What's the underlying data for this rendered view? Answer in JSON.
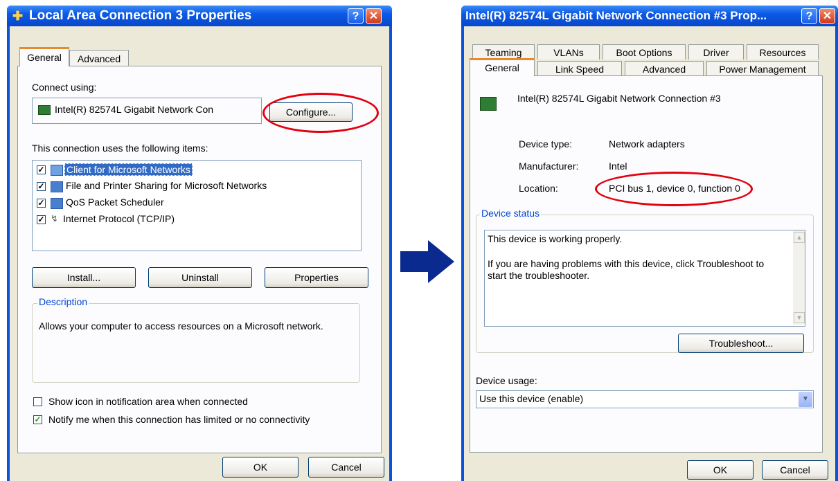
{
  "left": {
    "title": "Local Area Connection 3 Properties",
    "tabs": [
      "General",
      "Advanced"
    ],
    "connect_using_label": "Connect using:",
    "adapter_name": "Intel(R) 82574L Gigabit Network Con",
    "configure_label": "Configure...",
    "items_label": "This connection uses the following items:",
    "items": [
      {
        "label": "Client for Microsoft Networks",
        "checked": true,
        "selected": true,
        "icon": "network-client-icon"
      },
      {
        "label": "File and Printer Sharing for Microsoft Networks",
        "checked": true,
        "selected": false,
        "icon": "network-service-icon"
      },
      {
        "label": "QoS Packet Scheduler",
        "checked": true,
        "selected": false,
        "icon": "network-service-icon"
      },
      {
        "label": "Internet Protocol (TCP/IP)",
        "checked": true,
        "selected": false,
        "icon": "protocol-icon"
      }
    ],
    "install_label": "Install...",
    "uninstall_label": "Uninstall",
    "properties_label": "Properties",
    "description_title": "Description",
    "description_text": "Allows your computer to access resources on a Microsoft network.",
    "show_icon_label": "Show icon in notification area when connected",
    "show_icon_checked": false,
    "notify_label": "Notify me when this connection has limited or no connectivity",
    "notify_checked": true,
    "ok_label": "OK",
    "cancel_label": "Cancel"
  },
  "right": {
    "title": "Intel(R) 82574L Gigabit Network Connection #3 Prop...",
    "tabs_row1": [
      "Teaming",
      "VLANs",
      "Boot Options",
      "Driver",
      "Resources"
    ],
    "tabs_row2": [
      "General",
      "Link Speed",
      "Advanced",
      "Power Management"
    ],
    "device_name": "Intel(R) 82574L Gigabit Network Connection #3",
    "device_type_label": "Device type:",
    "device_type_value": "Network adapters",
    "manufacturer_label": "Manufacturer:",
    "manufacturer_value": "Intel",
    "location_label": "Location:",
    "location_value": "PCI bus 1, device 0, function 0",
    "device_status_title": "Device status",
    "status_line1": "This device is working properly.",
    "status_line2": "If you are having problems with this device, click Troubleshoot to start the troubleshooter.",
    "troubleshoot_label": "Troubleshoot...",
    "device_usage_label": "Device usage:",
    "device_usage_value": "Use this device (enable)",
    "ok_label": "OK",
    "cancel_label": "Cancel"
  },
  "colors": {
    "highlight_oval": "#e3000f",
    "arrow": "#0b2a8f",
    "selection": "#316ac5"
  }
}
